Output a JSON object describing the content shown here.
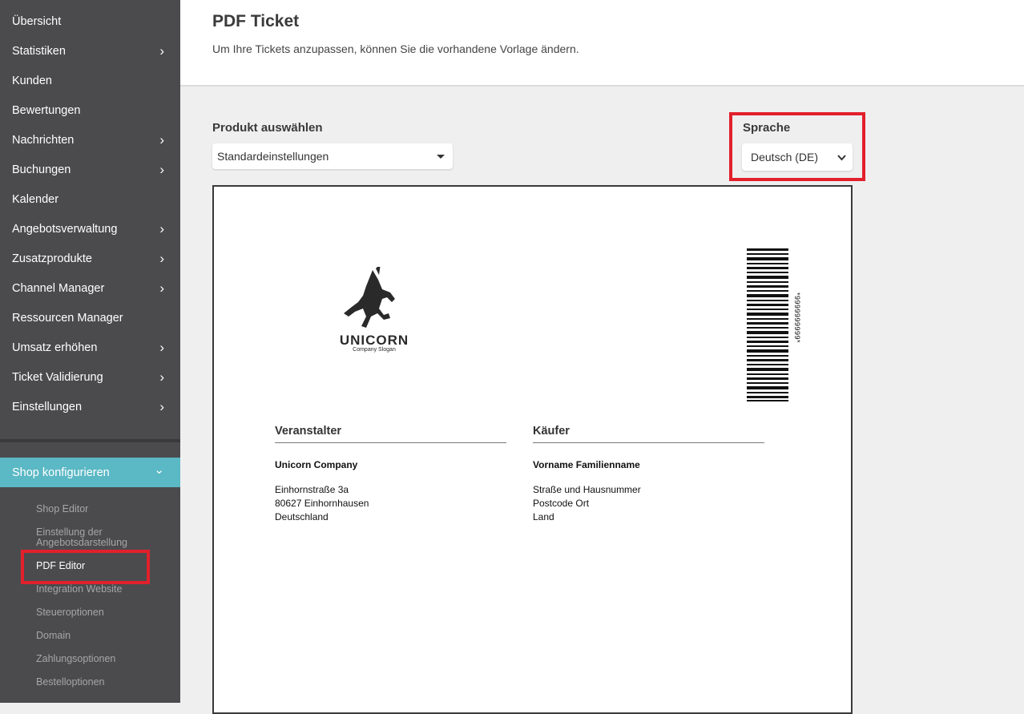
{
  "sidebar": {
    "items": [
      {
        "label": "Übersicht",
        "has_children": false
      },
      {
        "label": "Statistiken",
        "has_children": true
      },
      {
        "label": "Kunden",
        "has_children": false
      },
      {
        "label": "Bewertungen",
        "has_children": false
      },
      {
        "label": "Nachrichten",
        "has_children": true
      },
      {
        "label": "Buchungen",
        "has_children": true
      },
      {
        "label": "Kalender",
        "has_children": false
      },
      {
        "label": "Angebotsverwaltung",
        "has_children": true
      },
      {
        "label": "Zusatzprodukte",
        "has_children": true
      },
      {
        "label": "Channel Manager",
        "has_children": true
      },
      {
        "label": "Ressourcen Manager",
        "has_children": false
      },
      {
        "label": "Umsatz erhöhen",
        "has_children": true
      },
      {
        "label": "Ticket Validierung",
        "has_children": true
      },
      {
        "label": "Einstellungen",
        "has_children": true
      }
    ],
    "chevron_right": "›",
    "shop_config": {
      "label": "Shop konfigurieren",
      "chevron_down": "⌄",
      "color": "#5bb8c5"
    },
    "sub_items": [
      {
        "label": "Shop Editor",
        "active": false
      },
      {
        "label": "Einstellung der Angebotsdarstellung",
        "active": false
      },
      {
        "label": "PDF Editor",
        "active": true
      },
      {
        "label": "Integration Website",
        "active": false
      },
      {
        "label": "Steueroptionen",
        "active": false
      },
      {
        "label": "Domain",
        "active": false
      },
      {
        "label": "Zahlungsoptionen",
        "active": false
      },
      {
        "label": "Bestelloptionen",
        "active": false
      }
    ]
  },
  "header": {
    "title": "PDF Ticket",
    "subtitle": "Um Ihre Tickets anzupassen, können Sie die vorhandene Vorlage ändern."
  },
  "product_select": {
    "label": "Produkt auswählen",
    "value": "Standardeinstellungen"
  },
  "language_select": {
    "label": "Sprache",
    "value": "Deutsch (DE)"
  },
  "ticket": {
    "logo": {
      "name": "UNICORN",
      "slogan": "Company Slogan",
      "icon": "unicorn-logo-icon"
    },
    "barcode_text": "*9999999999*",
    "organizer": {
      "heading": "Veranstalter",
      "name": "Unicorn Company",
      "address": [
        "Einhornstraße 3a",
        "80627 Einhornhausen",
        "Deutschland"
      ]
    },
    "buyer": {
      "heading": "Käufer",
      "name": "Vorname Familienname",
      "address": [
        "Straße und Hausnummer",
        "Postcode Ort",
        "Land"
      ]
    }
  },
  "colors": {
    "sidebar_bg": "#4b4b4d",
    "accent": "#5bb8c5",
    "highlight": "#e2202c"
  }
}
